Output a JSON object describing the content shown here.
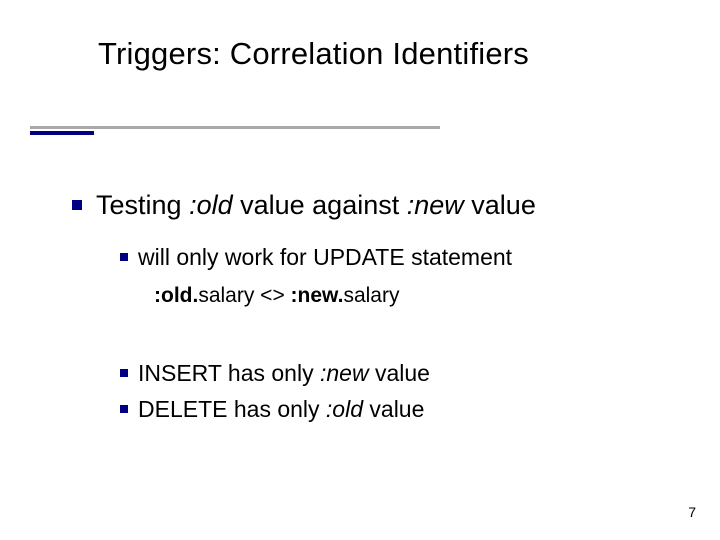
{
  "title": "Triggers: Correlation Identifiers",
  "lvl1": {
    "pre": "Testing ",
    "old": ":old",
    "mid": " value against ",
    "new": ":new",
    "post": " value"
  },
  "lvl2a": "will only work for UPDATE statement",
  "code": {
    "left_bold": ":old.",
    "left_rest": "salary <> ",
    "right_bold": ":new.",
    "right_rest": "salary"
  },
  "lvl2b": {
    "pre": "INSERT has only ",
    "kw": ":new",
    "post": " value"
  },
  "lvl2c": {
    "pre": "DELETE has only ",
    "kw": ":old",
    "post": " value"
  },
  "page": "7"
}
